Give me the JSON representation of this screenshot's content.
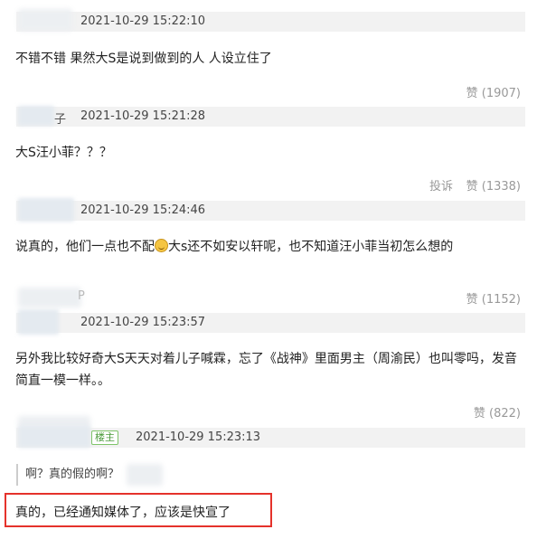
{
  "comments": [
    {
      "user_suffix": "",
      "time": "2021-10-29 15:22:10",
      "text": "不错不错 果然大S是说到做到的人 人设立住了",
      "likes": "赞 (1907)"
    },
    {
      "user_suffix": "子",
      "time": "2021-10-29 15:21:28",
      "text": "大S汪小菲？？？",
      "report": "投诉",
      "likes": "赞 (1338)"
    },
    {
      "user_suffix": "",
      "time": "2021-10-29 15:24:46",
      "text_a": "说真的，他们一点也不配",
      "emoji": "grinning-sweat-emoji",
      "text_b": "大s还不如安以轩呢，也不知道汪小菲当初怎么想的",
      "likes": "赞 (1152)"
    },
    {
      "user_suffix": "P",
      "time": "2021-10-29 15:23:57",
      "text_line1": "另外我比较好奇大S天天对着儿子喊霖，忘了《战神》里面男主（周渝民）也叫零吗，发音",
      "text_line2": "简直一模一样。。",
      "likes": "赞 (822)"
    },
    {
      "badge": "楼主",
      "time": "2021-10-29 15:23:13",
      "quote": "啊？真的假的啊？",
      "reply": "真的，已经通知媒体了，应该是快宣了"
    }
  ],
  "colors": {
    "highlight_border": "#e5322b",
    "badge_green": "#4a9a3a"
  }
}
